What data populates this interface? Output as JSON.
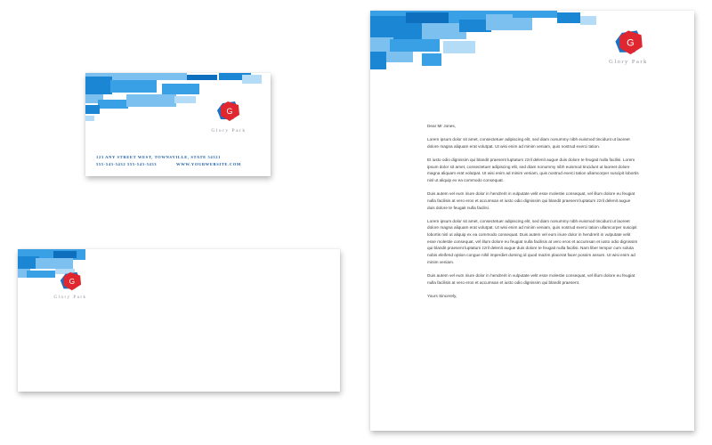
{
  "brand": {
    "name": "Glory Park",
    "logo_letter": "G",
    "colors": {
      "primary_blue": "#1a86d4",
      "light_blue": "#7cc0ef",
      "logo_red": "#e0262e",
      "logo_blue": "#1e6fc4"
    }
  },
  "business_card": {
    "address": "123 ANY STREET WEST, TOWNSVILLE, STATE 54321",
    "phone_fax": "555-543-5432   555-543-5433",
    "website": "WWW.YOURWEBSITE.COM"
  },
  "letter": {
    "greeting": "Dear Mr Jones,",
    "paragraphs": [
      "Lorem ipsum dolor sit amet, consectetuer adipiscing elit, sed diam nonummy nibh euismod tincidunt ut laoreet dolore magna aliquam erat volutpat. Ut wisi enim ad minim veniam, quis nostrud exerci tation.",
      "Et iusto odio dignissim qui blandit praesent luptatum zzril delenit augue duis dolore te feugait nulla facilisi. Lorem ipsum dolor sit amet, consectetuer adipiscing elit, sed diam nonummy nibh euismod tincidunt ut laoreet dolore magna aliquam erat volutpat. Ut wisi enim ad minim veniam, quis nostrud exerci tation ullamcorper suscipit lobortis nisl ut aliquip ex ea commodo consequat.",
      "Duis autem vel eum iriure dolor in hendrerit in vulputate velit esse molestie consequat, vel illum dolore eu feugiat nulla facilisis at vero eros et accumsan et iusto odio dignissim qui blandit praesent luptatum zzril delenit augue duis dolore te feugait nulla facilisi.",
      "Lorem ipsum dolor sit amet, consectetuer adipiscing elit, sed diam nonummy nibh euismod tincidunt ut laoreet dolore magna aliquam erat volutpat. Ut wisi enim ad minim veniam, quis nostrud exerci tation ullamcorper suscipit lobortis nisl ut aliquip ex ea commodo consequat. Duis autem vel eum iriure dolor in hendrerit in vulputate velit esse molestie consequat, vel illum dolore eu feugiat nulla facilisis at vero eros et accumsan et iusto odio dignissim qui blandit praesent luptatum zzril delenit augue duis dolore te feugait nulla facilisi. Nam liber tempor cum soluta nobis eleifend option congue nihil imperdiet doming id quod mazim placerat facer possim assum. Ut wisi enim ad minim veniam.",
      "Duis autem vel eum iriure dolor in hendrerit in vulputate velit esse molestie consequat, vel illum dolore eu feugiat nulla facilisis at vero eros et accumsan et iusto odio dignissim qui blandit praesent.",
      "Yours Sincerely,"
    ]
  }
}
